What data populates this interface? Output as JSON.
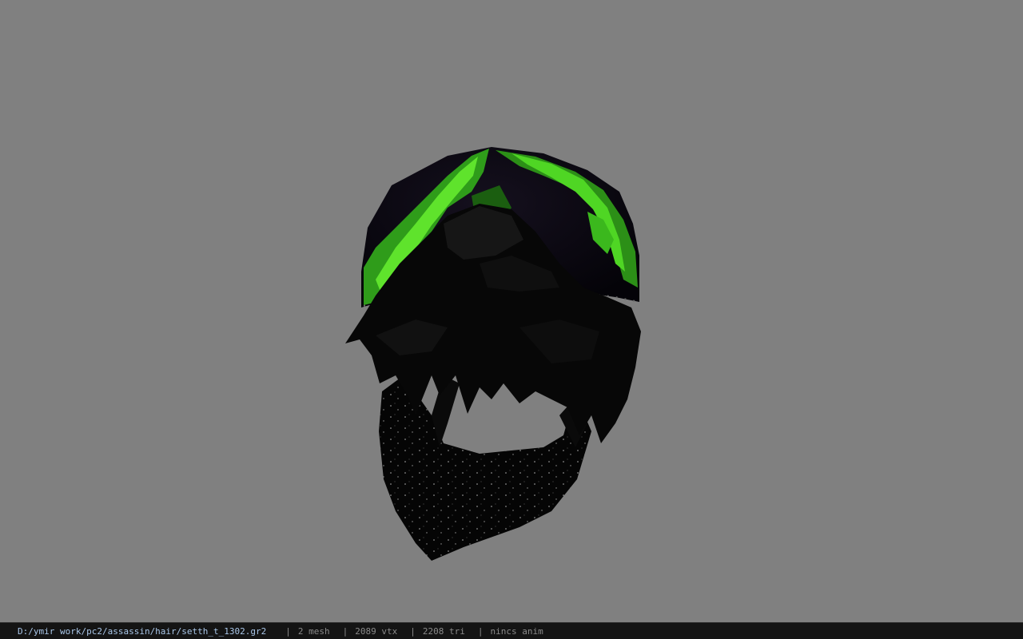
{
  "viewport": {
    "background_color": "#808080",
    "model_name": "seth hair with green bandana and black mask"
  },
  "status_bar": {
    "file_path": "D:/ymir work/pc2/assassin/hair/setth_t_1302.gr2",
    "separator": "|",
    "mesh_count": "2 mesh",
    "vertex_count": "2089 vtx",
    "triangle_count": "2208 tri",
    "animation": "nincs anim",
    "path_color": "#a9c6e8"
  }
}
